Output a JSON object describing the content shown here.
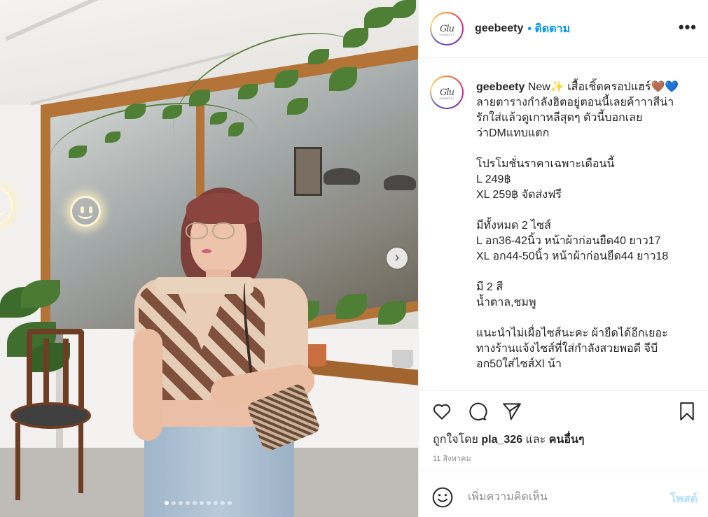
{
  "post": {
    "username": "geebeety",
    "follow_separator": "•",
    "follow_label": "ติดตาม",
    "more_label": "•••",
    "avatar_text": "Glu",
    "avatar_subtext": "GEEBEETY",
    "next_label": "›",
    "carousel_count": 10,
    "carousel_active": 0
  },
  "caption": {
    "username": "geebeety",
    "text": "New✨ เสื้อเชิ้ตครอปแฮร์🤎💙 ลายตารางกำลังฮิตอยู่ตอนนี้เลยค้าาาสีน่ารักใส่แล้วดูเกาหลีสุดๆ ตัวนี้บอกเลยว่าDMแทบแตก\n\nโปรโมชั่นราคาเฉพาะเดือนนี้\nL 249฿\nXL 259฿ จัดส่งฟรี\n\nมีทั้งหมด 2 ไซส์\nL อก36-42นิ้ว หน้าผ้าก่อนยืด40 ยาว17\nXL อก44-50นิ้ว หน้าผ้าก่อนยืด44 ยาว18\n\nมี 2 สี\nน้ำตาล,ชมพู\n\nแนะนำไม่เผื่อไซส์นะคะ ผ้ายืดได้อีกเยอะ ทางร้านแจ้งไซส์ที่ใส่กำลังสวยพอดี จีบีอก50ใส่ไซส์Xl น้า"
  },
  "engagement": {
    "liked_by_prefix": "ถูกใจโดย",
    "liked_by_user": "pla_326",
    "liked_by_and": "และ",
    "liked_by_others": "คนอื่นๆ",
    "date": "11 สิงหาคม"
  },
  "icons": {
    "like": "heart-icon",
    "comment": "comment-icon",
    "share": "share-icon",
    "save": "bookmark-icon",
    "emoji": "emoji-icon"
  },
  "comment": {
    "placeholder": "เพิ่มความคิดเห็น",
    "post_label": "โพสต์"
  },
  "colors": {
    "link": "#0095f6",
    "post_disabled": "#b2dffc",
    "muted": "#8e8e8e"
  }
}
